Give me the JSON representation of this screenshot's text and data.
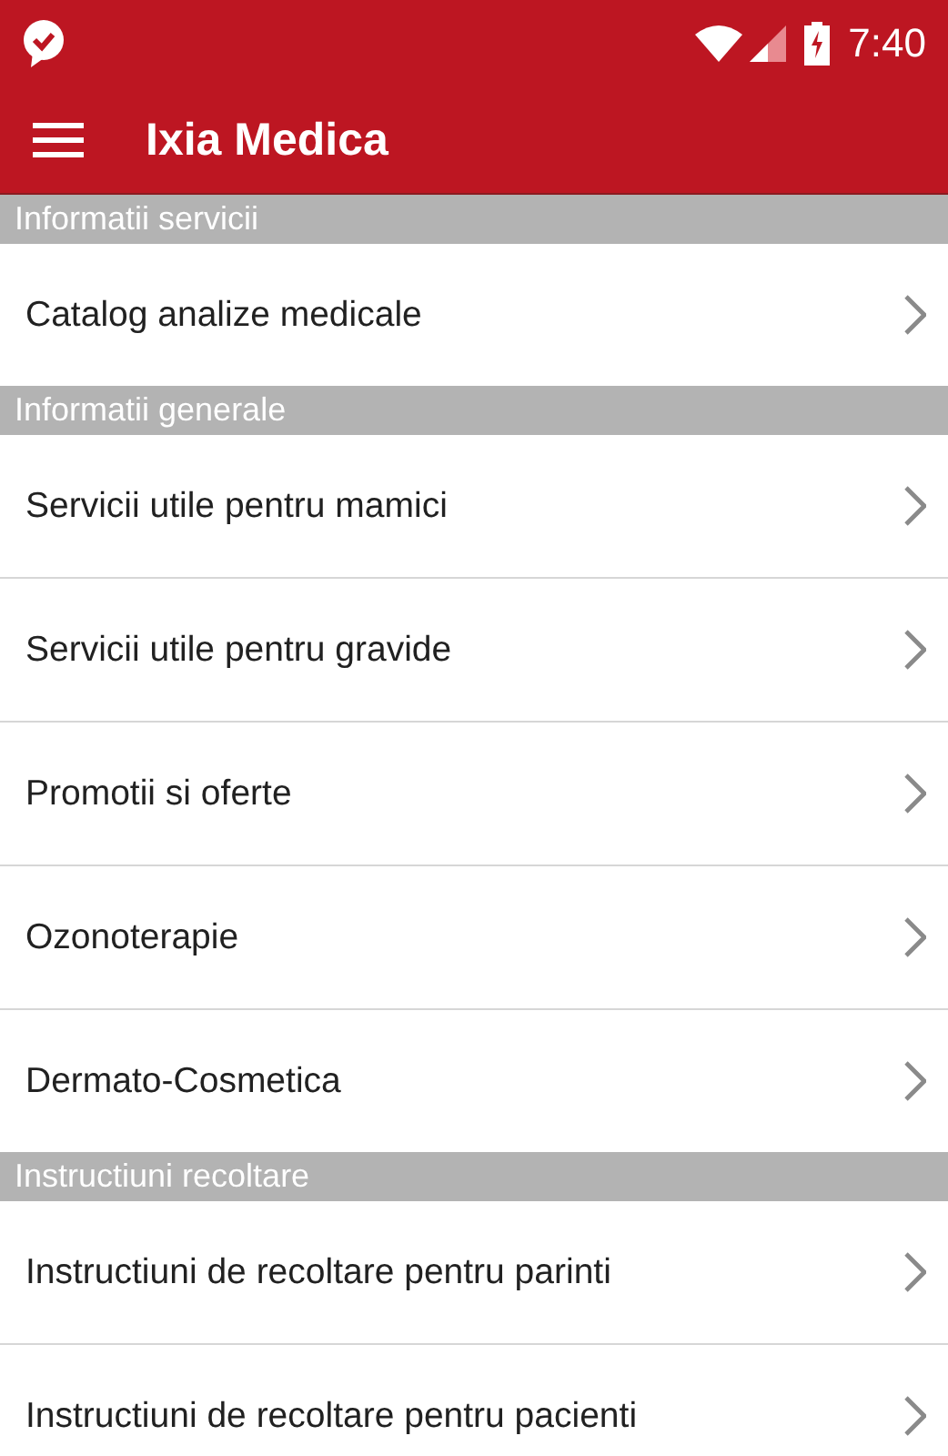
{
  "status_bar": {
    "time": "7:40"
  },
  "app_bar": {
    "title": "Ixia Medica"
  },
  "sections": [
    {
      "header": "Informatii servicii",
      "items": [
        "Catalog analize medicale"
      ]
    },
    {
      "header": "Informatii generale",
      "items": [
        "Servicii utile pentru mamici",
        "Servicii utile pentru gravide",
        "Promotii si oferte",
        "Ozonoterapie",
        "Dermato-Cosmetica"
      ]
    },
    {
      "header": "Instructiuni recoltare",
      "items": [
        "Instructiuni de recoltare pentru parinti",
        "Instructiuni de recoltare pentru pacienti"
      ]
    }
  ]
}
